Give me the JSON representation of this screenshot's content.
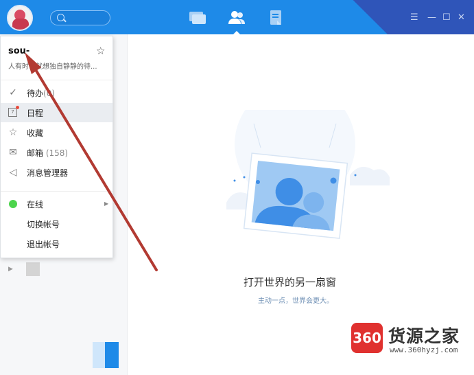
{
  "profile": {
    "name": "sou-",
    "signature": "人有时候就想独自静静的待..."
  },
  "menu": {
    "items": [
      {
        "label": "待办",
        "count": "(0)"
      },
      {
        "label": "日程",
        "count": ""
      },
      {
        "label": "收藏",
        "count": ""
      },
      {
        "label": "邮箱",
        "count": "(158)"
      },
      {
        "label": "消息管理器",
        "count": ""
      },
      {
        "label": "在线",
        "count": ""
      },
      {
        "label": "切换帐号",
        "count": ""
      },
      {
        "label": "退出帐号",
        "count": ""
      }
    ]
  },
  "main": {
    "headline": "打开世界的另一扇窗",
    "subline": "主动一点，世界会更大。"
  },
  "watermark": {
    "logo_text": "360",
    "site_name": "货源之家",
    "url": "www.360hyzj.com"
  },
  "colors": {
    "titlebar": "#1e8ae8",
    "titlebar_dark": "#2f55b9",
    "annotation_arrow": "#b23a32",
    "online_status": "#4cd44c",
    "watermark_red": "#e0312f"
  },
  "icons": {
    "tab_messages": "chat-window-icon",
    "tab_contacts": "contacts-icon",
    "tab_documents": "document-icon"
  }
}
